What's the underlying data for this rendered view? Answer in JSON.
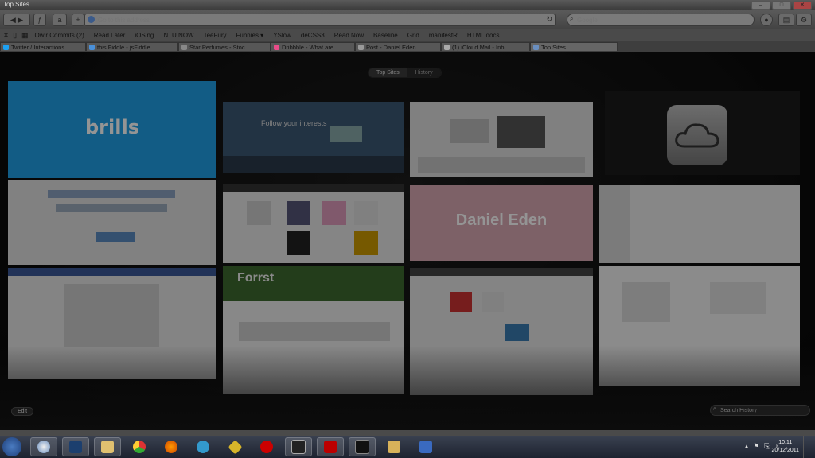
{
  "window": {
    "title": "Top Sites"
  },
  "toolbar": {
    "address_placeholder": "Go to this address",
    "search_placeholder": "Google"
  },
  "bookmarks": [
    "Owlr Commits (2)",
    "Read Later",
    "iOSing",
    "NTU NOW",
    "TeeFury",
    "Funnies ▾",
    "YSlow",
    "deCSS3",
    "Read Now",
    "Baseline",
    "Grid",
    "manifestR",
    "HTML docs"
  ],
  "tabs": [
    {
      "label": "Twitter / Interactions",
      "fav": "#1da1f2"
    },
    {
      "label": "this Fiddle - jsFiddle ...",
      "fav": "#4a90d9"
    },
    {
      "label": "Star Perfumes - Stoc...",
      "fav": "#888888"
    },
    {
      "label": "Dribbble - What are ...",
      "fav": "#ea4c89"
    },
    {
      "label": "Post - Daniel Eden ...",
      "fav": "#999999"
    },
    {
      "label": "(1) iCloud Mail - Inb...",
      "fav": "#aaaaaa"
    },
    {
      "label": "Top Sites",
      "fav": "#6a8fc0"
    }
  ],
  "segmented": {
    "top_sites": "Top Sites",
    "history": "History"
  },
  "thumbs": {
    "brills": "brills",
    "daniel": "Daniel Eden",
    "forrst": "Forrst",
    "follow": "Follow your interests"
  },
  "footer": {
    "edit": "Edit",
    "search_history_placeholder": "Search History"
  },
  "clock": {
    "time": "10:11",
    "date": "20/12/2011"
  },
  "colors": {
    "brills": "#1f9fe6",
    "daniel": "#d8a7b2",
    "forrst": "#3d6a2f"
  }
}
